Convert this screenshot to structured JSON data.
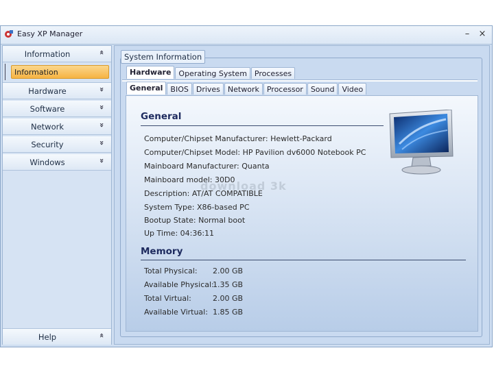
{
  "window": {
    "title": "Easy XP Manager",
    "minimize": "–",
    "close": "×"
  },
  "sidebar": {
    "top": {
      "label": "Information"
    },
    "active_item": "Information",
    "items": [
      {
        "label": "Hardware"
      },
      {
        "label": "Software"
      },
      {
        "label": "Network"
      },
      {
        "label": "Security"
      },
      {
        "label": "Windows"
      }
    ],
    "bottom": {
      "label": "Help"
    },
    "expand_glyph": "»",
    "collapse_glyph": "«"
  },
  "main": {
    "group_label": "System Information",
    "tabs": [
      "Hardware",
      "Operating System",
      "Processes"
    ],
    "subtabs": [
      "General",
      "BIOS",
      "Drives",
      "Network",
      "Processor",
      "Sound",
      "Video"
    ],
    "watermark": "download 3k",
    "general": {
      "title": "General",
      "rows": [
        "Computer/Chipset Manufacturer: Hewlett-Packard",
        "Computer/Chipset Model: HP Pavilion dv6000 Notebook PC",
        "Mainboard Manufacturer: Quanta",
        "Mainboard model: 30D0",
        "Description: AT/AT COMPATIBLE",
        "System Type: X86-based PC",
        "Bootup State: Normal boot",
        "Up Time: 04:36:11"
      ]
    },
    "memory": {
      "title": "Memory",
      "rows": [
        {
          "label": "Total Physical:",
          "value": "2.00 GB"
        },
        {
          "label": "Available Physical:",
          "value": "1.35 GB"
        },
        {
          "label": "Total Virtual:",
          "value": "2.00 GB"
        },
        {
          "label": "Available Virtual:",
          "value": "1.85 GB"
        }
      ]
    }
  }
}
